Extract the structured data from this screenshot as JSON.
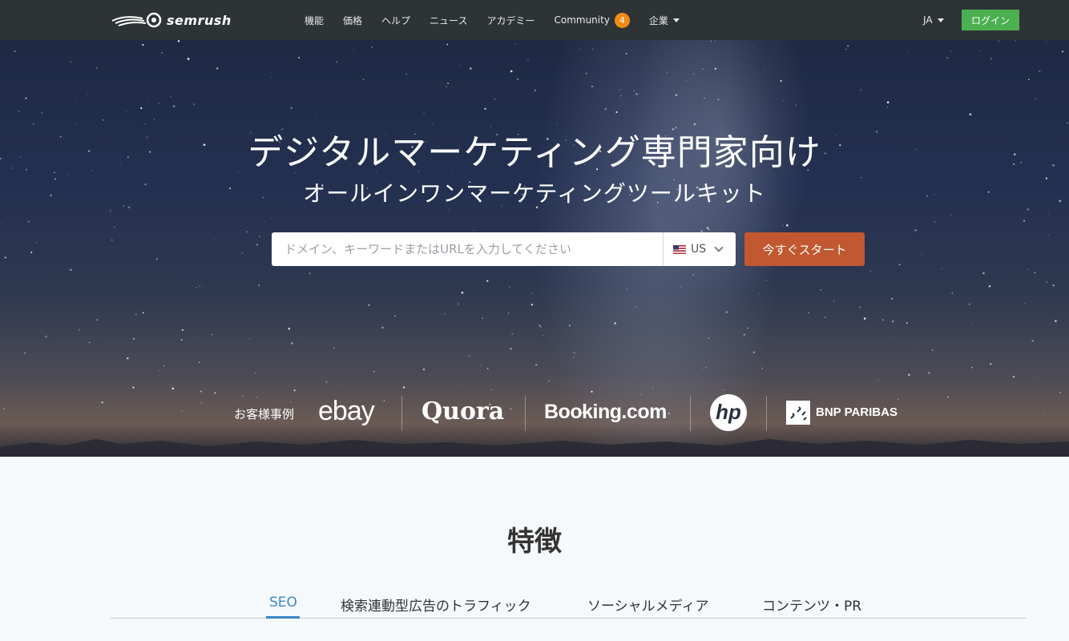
{
  "nav": {
    "logo": "semrush",
    "items": [
      {
        "label": "機能"
      },
      {
        "label": "価格"
      },
      {
        "label": "ヘルプ"
      },
      {
        "label": "ニュース"
      },
      {
        "label": "アカデミー"
      },
      {
        "label": "Community",
        "badge": "4"
      },
      {
        "label": "企業"
      }
    ],
    "lang": "JA",
    "login": "ログイン"
  },
  "hero": {
    "title": "デジタルマーケティング専門家向け",
    "subtitle": "オールインワンマーケティングツールキット",
    "search_placeholder": "ドメイン、キーワードまたはURLを入力してください",
    "db": "US",
    "start": "今すぐスタート",
    "clients_label": "お客様事例",
    "clients": [
      "ebay",
      "Quora",
      "Booking.com",
      "hp",
      "BNP PARIBAS"
    ]
  },
  "features": {
    "title": "特徴",
    "tabs": [
      "SEO",
      "検索連動型広告のトラフィック",
      "ソーシャルメディア",
      "コンテンツ・PR"
    ],
    "active_tab": 0
  },
  "colors": {
    "navbar": "#2e3436",
    "login": "#4caf50",
    "start": "#c2582f",
    "badge": "#f28c14",
    "active_tab": "#3a86c6"
  }
}
